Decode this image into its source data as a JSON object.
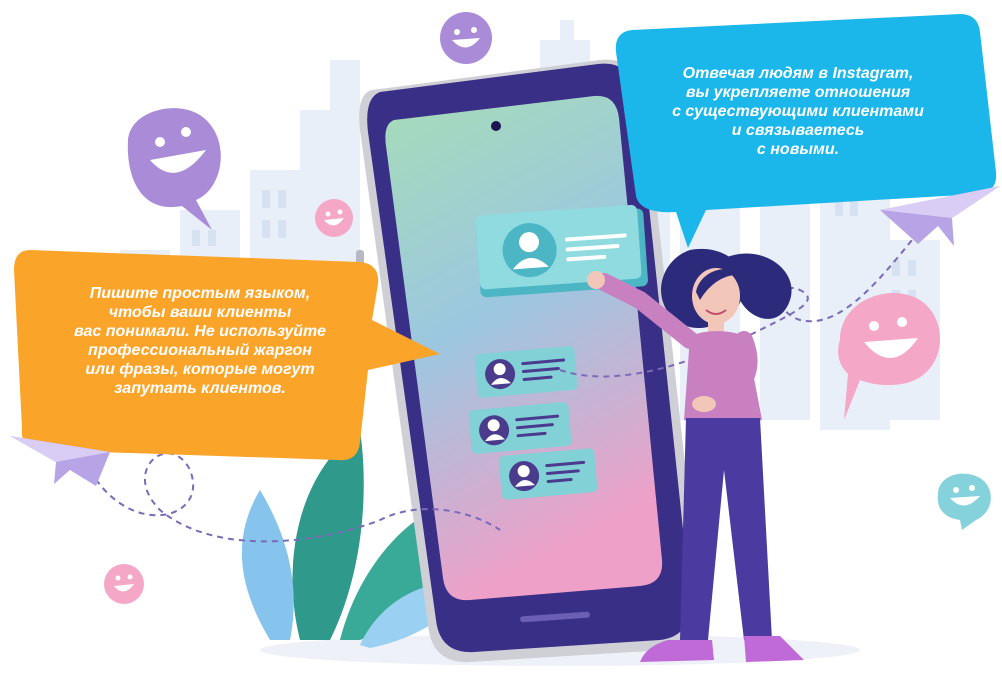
{
  "callouts": {
    "blue": {
      "color": "#1bb6ea",
      "lines": [
        "Отвечая людям в Instagram,",
        "вы укрепляете  отношения",
        "с существующими клиентами",
        "и связываетесь",
        "с новыми."
      ]
    },
    "orange": {
      "color": "#fba42a",
      "lines": [
        "Пишите простым языком,",
        "чтобы ваши клиенты",
        "вас понимали. Не используйте",
        "профессиональный жаргон",
        "или фразы, которые могут",
        "запутать клиентов."
      ]
    }
  },
  "palette": {
    "phone_frame": "#3a2f86",
    "phone_edge": "#c9c9cf",
    "screen_top": "#9fd8b4",
    "screen_bottom": "#e79cc6",
    "card": "#7fd3d6",
    "avatar": "#4a3b8c",
    "smiley_purple": "#a98bd8",
    "smiley_pink": "#f4a7c7",
    "smiley_teal": "#86d2dc",
    "city": "#e6eef8",
    "shirt": "#c880c0",
    "pants": "#4b3aa0",
    "hair": "#2c2a7a",
    "shoes": "#c06ad8",
    "leaf_teal": "#2f9a8c",
    "leaf_blue": "#86c4ee"
  },
  "icons": [
    "smiley-bubble-icon",
    "paper-plane-icon",
    "user-avatar-icon",
    "message-lines-icon",
    "leaf-plant-icon"
  ]
}
